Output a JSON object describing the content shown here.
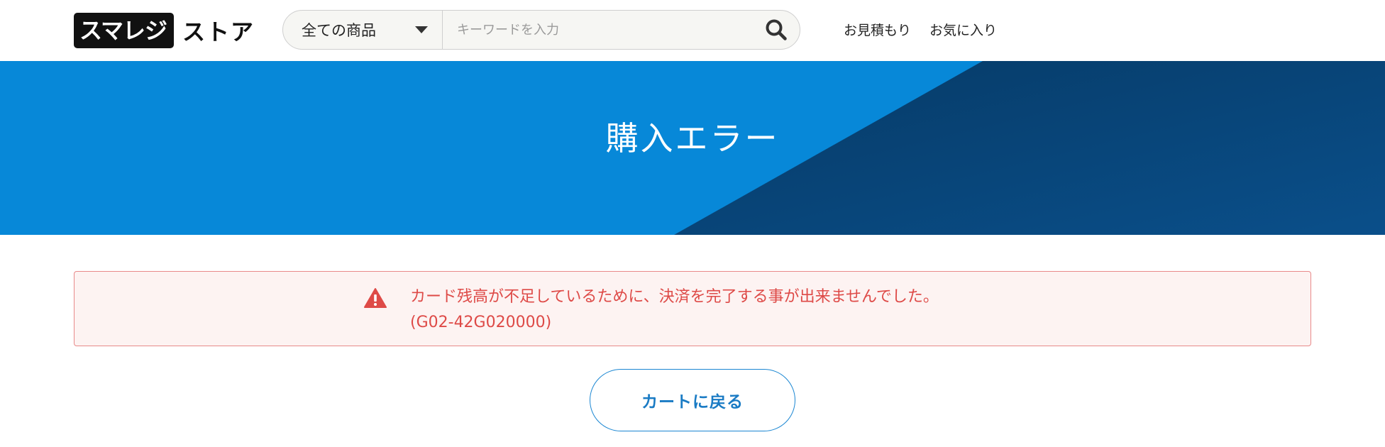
{
  "header": {
    "logo": {
      "box_text": "スマレジ",
      "text": "ストア"
    },
    "search": {
      "category_selected": "全ての商品",
      "placeholder": "キーワードを入力",
      "search_icon": "search-icon"
    },
    "nav": [
      {
        "label": "お見積もり"
      },
      {
        "label": "お気に入り"
      }
    ]
  },
  "hero": {
    "title": "購入エラー"
  },
  "alert": {
    "icon": "warning-icon",
    "message_line1": "カード残高が不足しているために、決済を完了する事が出来ませんでした。",
    "message_line2": "(G02-42G020000)"
  },
  "actions": {
    "back_label": "カートに戻る"
  },
  "colors": {
    "brand_blue": "#0788d8",
    "hero_dark": "#063f6e",
    "error_text": "#de4a47",
    "error_bg": "#fdf3f2",
    "error_border": "#e88a8a",
    "button_text": "#1a7bc4"
  }
}
